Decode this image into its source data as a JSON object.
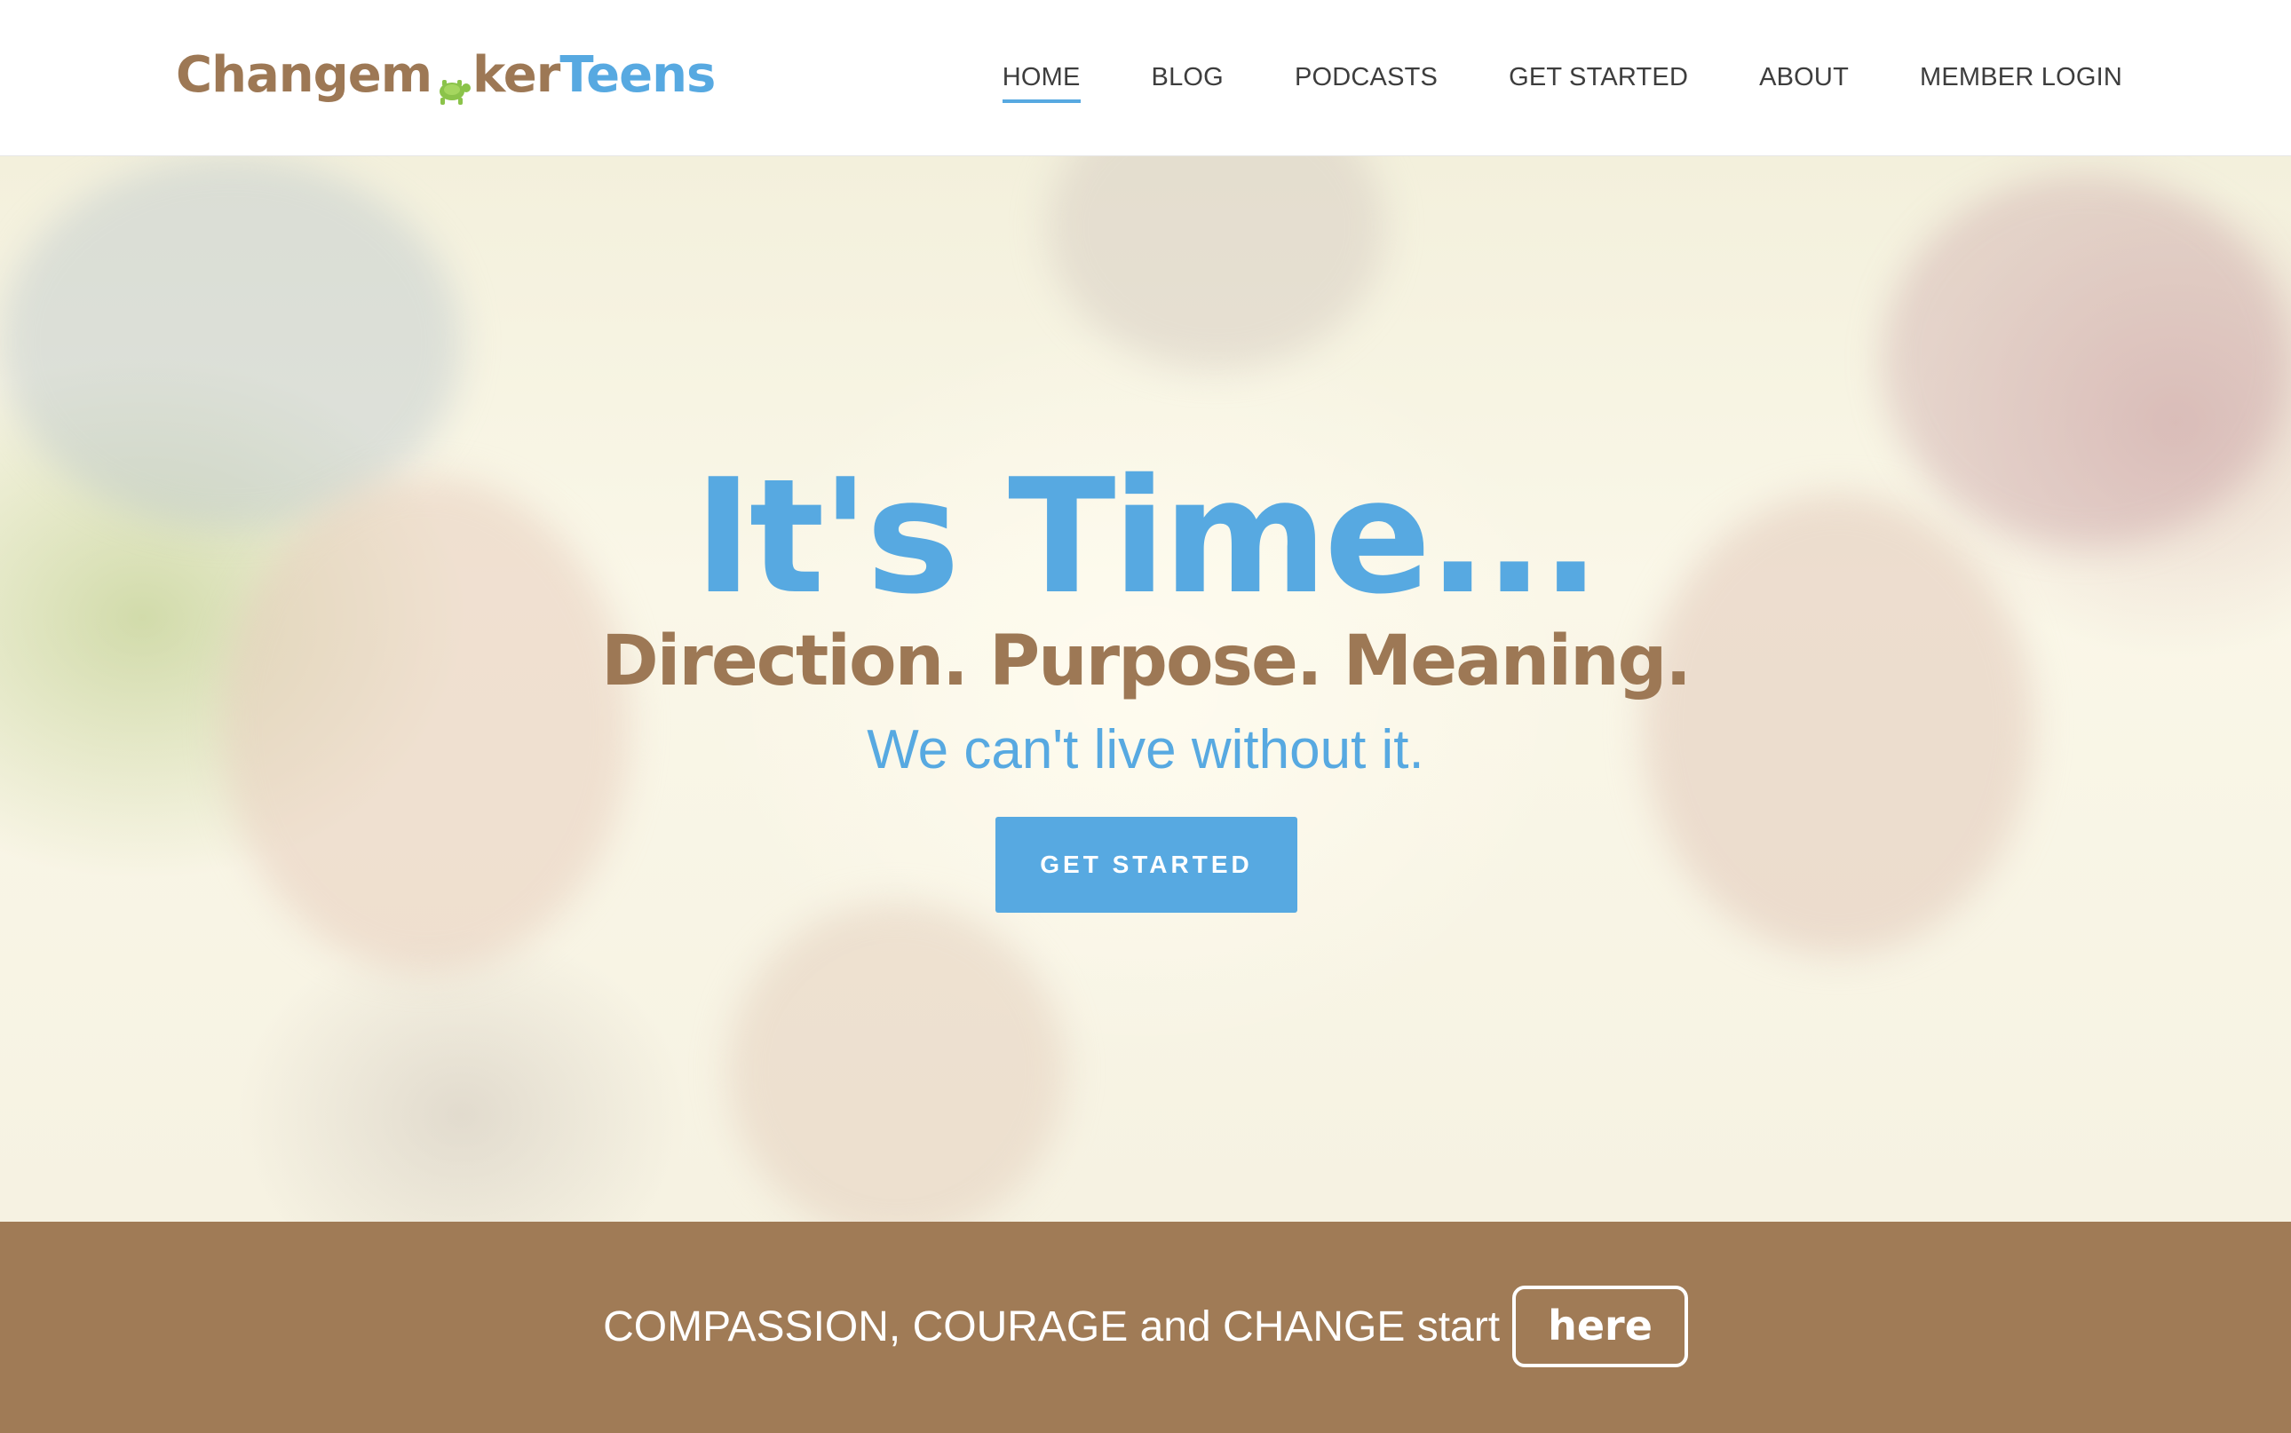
{
  "header": {
    "logo": {
      "part1": "Changem",
      "part2": "ker",
      "part3": "Teens"
    },
    "nav": [
      {
        "label": "HOME",
        "active": true
      },
      {
        "label": "BLOG",
        "active": false
      },
      {
        "label": "PODCASTS",
        "active": false
      },
      {
        "label": "GET STARTED",
        "active": false
      },
      {
        "label": "ABOUT",
        "active": false
      },
      {
        "label": "MEMBER LOGIN",
        "active": false
      }
    ]
  },
  "hero": {
    "title": "It's Time...",
    "subtitle": "Direction. Purpose. Meaning.",
    "tagline": "We can't live without it.",
    "button_label": "GET STARTED"
  },
  "banner": {
    "text": "COMPASSION, COURAGE and CHANGE start",
    "button_label": "here"
  },
  "colors": {
    "brand_blue": "#57a9e1",
    "brand_brown": "#9d7855",
    "banner_brown": "#a07b56"
  },
  "icons": {
    "logo_mark": "turtle-icon"
  }
}
